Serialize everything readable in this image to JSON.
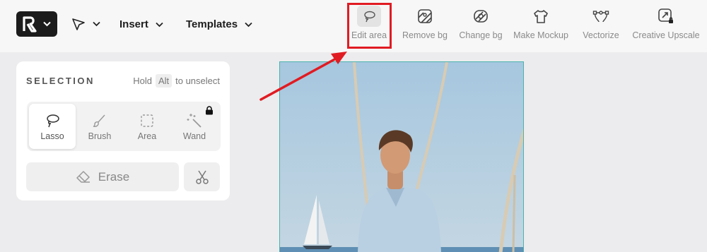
{
  "toolbar": {
    "insert_label": "Insert",
    "templates_label": "Templates",
    "actions": [
      {
        "label": "Edit area",
        "icon": "lasso-icon",
        "active": true
      },
      {
        "label": "Remove bg",
        "icon": "remove-bg-icon"
      },
      {
        "label": "Change bg",
        "icon": "change-bg-icon"
      },
      {
        "label": "Make Mockup",
        "icon": "shirt-icon"
      },
      {
        "label": "Vectorize",
        "icon": "vector-nodes-icon"
      },
      {
        "label": "Creative Upscale",
        "icon": "upscale-icon"
      }
    ]
  },
  "panel": {
    "title": "SELECTION",
    "hint_prefix": "Hold",
    "hint_key": "Alt",
    "hint_suffix": "to unselect",
    "modes": [
      {
        "label": "Lasso",
        "icon": "lasso-icon",
        "selected": true
      },
      {
        "label": "Brush",
        "icon": "brush-icon"
      },
      {
        "label": "Area",
        "icon": "area-select-icon"
      },
      {
        "label": "Wand",
        "icon": "magic-wand-icon",
        "locked": true
      }
    ],
    "erase_label": "Erase"
  },
  "colors": {
    "highlight": "#e11b22",
    "logo_bg": "#1c1c1c",
    "canvas_border": "#4bb3ad"
  }
}
